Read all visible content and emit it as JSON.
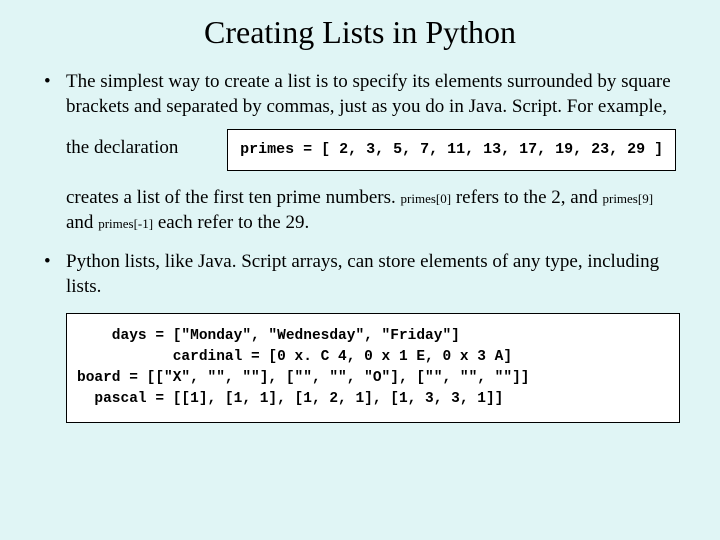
{
  "title": "Creating Lists in Python",
  "bullet1": "The simplest way to create a list is to specify its elements surrounded by square brackets and separated by commas, just as you do in Java. Script.  For example, the declaration",
  "code1": "primes = [ 2, 3, 5, 7, 11, 13, 17, 19, 23, 29 ]",
  "follow_a": "creates a list of the first ten prime numbers.  ",
  "inline1": "primes[0]",
  "follow_b": " refers to the 2, and ",
  "inline2": "primes[9]",
  "follow_c": " and ",
  "inline3": "primes[-1]",
  "follow_d": " each refer to the 29.",
  "bullet2": "Python lists, like Java. Script arrays, can store elements of any type, including lists.",
  "code2_l1": "    days = [\"Monday\", \"Wednesday\", \"Friday\"]",
  "code2_l2": "           cardinal = [0 x. C 4, 0 x 1 E, 0 x 3 A]",
  "code2_l3": "board = [[\"X\", \"\", \"\"], [\"\", \"\", \"O\"], [\"\", \"\", \"\"]]",
  "code2_l4": "  pascal = [[1], [1, 1], [1, 2, 1], [1, 3, 3, 1]]",
  "chart_data": {
    "type": "table",
    "title": "Creating Lists in Python",
    "lists": {
      "primes": [
        2,
        3,
        5,
        7,
        11,
        13,
        17,
        19,
        23,
        29
      ],
      "days": [
        "Monday",
        "Wednesday",
        "Friday"
      ],
      "cardinal": [
        "0 x. C 4",
        "0 x 1 E",
        "0 x 3 A"
      ],
      "board": [
        [
          "X",
          "",
          ""
        ],
        [
          "",
          "",
          "O"
        ],
        [
          "",
          "",
          ""
        ]
      ],
      "pascal": [
        [
          1
        ],
        [
          1,
          1
        ],
        [
          1,
          2,
          1
        ],
        [
          1,
          3,
          3,
          1
        ]
      ]
    }
  }
}
